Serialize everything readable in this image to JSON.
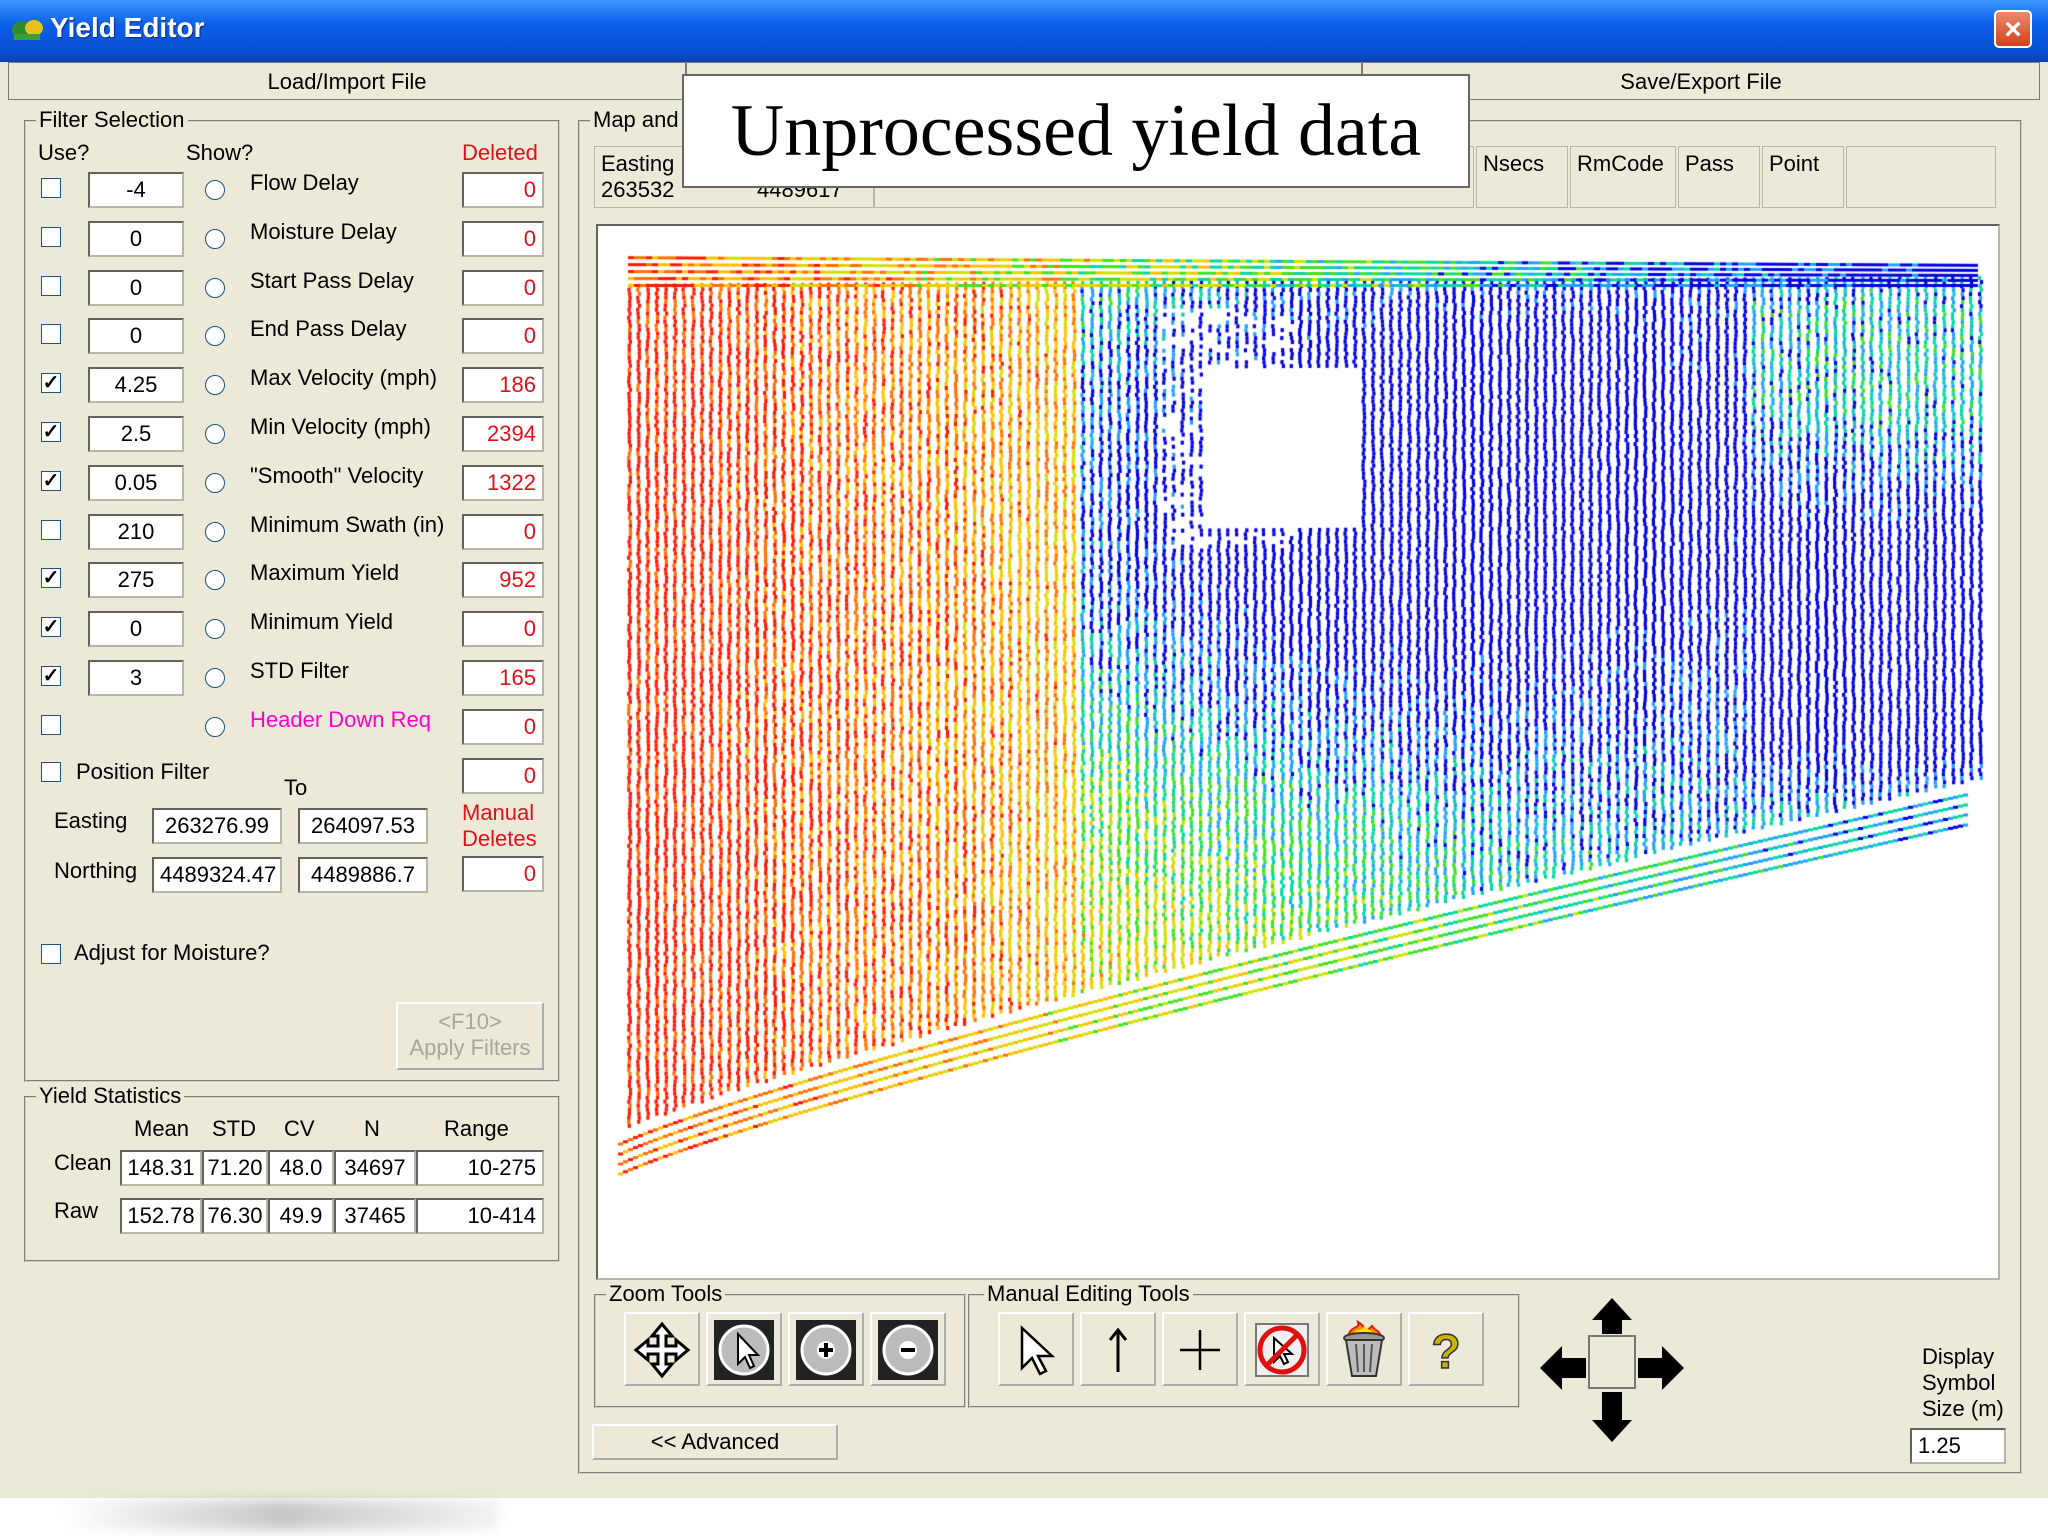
{
  "window": {
    "title": "Yield Editor"
  },
  "tabs": [
    {
      "label": "Load/Import File"
    },
    {
      "label": ""
    },
    {
      "label": "Save/Export File"
    }
  ],
  "overlay_text": "Unprocessed yield data",
  "filter": {
    "title": "Filter Selection",
    "use_label": "Use?",
    "show_label": "Show?",
    "deleted_label": "Deleted",
    "rows": [
      {
        "name": "Flow Delay",
        "checked": false,
        "value": "-4",
        "deleted": "0",
        "color": "#000000"
      },
      {
        "name": "Moisture Delay",
        "checked": false,
        "value": "0",
        "deleted": "0",
        "color": "#000000"
      },
      {
        "name": "Start Pass Delay",
        "checked": false,
        "value": "0",
        "deleted": "0",
        "color": "#000000"
      },
      {
        "name": "End Pass Delay",
        "checked": false,
        "value": "0",
        "deleted": "0",
        "color": "#000000"
      },
      {
        "name": "Max Velocity (mph)",
        "checked": true,
        "value": "4.25",
        "deleted": "186",
        "color": "#000000"
      },
      {
        "name": "Min Velocity (mph)",
        "checked": true,
        "value": "2.5",
        "deleted": "2394",
        "color": "#000000"
      },
      {
        "name": "\"Smooth\" Velocity",
        "checked": true,
        "value": "0.05",
        "deleted": "1322",
        "color": "#000000"
      },
      {
        "name": "Minimum Swath (in)",
        "checked": false,
        "value": "210",
        "deleted": "0",
        "color": "#000000"
      },
      {
        "name": "Maximum Yield",
        "checked": true,
        "value": "275",
        "deleted": "952",
        "color": "#000000"
      },
      {
        "name": "Minimum Yield",
        "checked": true,
        "value": "0",
        "deleted": "0",
        "color": "#000000"
      },
      {
        "name": "STD Filter",
        "checked": true,
        "value": "3",
        "deleted": "165",
        "color": "#000000"
      },
      {
        "name": "Header Down Req",
        "checked": false,
        "value": "",
        "deleted": "0",
        "color": "#ff00cc"
      }
    ],
    "position": {
      "label": "Position Filter",
      "deleted": "0",
      "to_label": "To",
      "easting_label": "Easting",
      "northing_label": "Northing",
      "easting_from": "263276.99",
      "easting_to": "264097.53",
      "northing_from": "4489324.47",
      "northing_to": "4489886.7",
      "manual_label": "Manual",
      "deletes_label": "Deletes",
      "manual_deletes": "0"
    },
    "moisture_label": "Adjust for Moisture?",
    "apply_key": "<F10>",
    "apply_label": "Apply Filters"
  },
  "stats": {
    "title": "Yield Statistics",
    "headers": [
      "Mean",
      "STD",
      "CV",
      "N",
      "Range"
    ],
    "rows": [
      {
        "label": "Clean",
        "values": [
          "148.31",
          "71.20",
          "48.0",
          "34697",
          "10-275"
        ]
      },
      {
        "label": "Raw",
        "values": [
          "152.78",
          "76.30",
          "49.9",
          "37465",
          "10-414"
        ]
      }
    ]
  },
  "map": {
    "title": "Map and",
    "columns": [
      {
        "label": "Easting",
        "value": "263532"
      },
      {
        "label": "",
        "value": "4489617"
      },
      {
        "label": "Nsecs",
        "value": ""
      },
      {
        "label": "RmCode",
        "value": ""
      },
      {
        "label": "Pass",
        "value": ""
      },
      {
        "label": "Point",
        "value": ""
      }
    ]
  },
  "zoom_tools": {
    "title": "Zoom Tools",
    "items": [
      "pan-icon",
      "zoom-window-icon",
      "zoom-in-icon",
      "zoom-out-icon"
    ]
  },
  "edit_tools": {
    "title": "Manual Editing Tools",
    "items": [
      "select-arrow-icon",
      "up-arrow-icon",
      "crosshair-icon",
      "no-edit-icon",
      "trash-fire-icon",
      "help-icon"
    ]
  },
  "advanced_label": "<< Advanced",
  "display_symbol": {
    "line1": "Display",
    "line2": "Symbol",
    "line3": "Size (m)",
    "value": "1.25"
  },
  "colors": {
    "title_bar": "#0a5fe8",
    "deleted_text": "#e0101a",
    "header_down": "#ff00cc",
    "face": "#ece9d8"
  },
  "yield_palette": [
    "#0000e0",
    "#20a0ff",
    "#00d8a0",
    "#40e020",
    "#d0e000",
    "#ffc000",
    "#ff7000",
    "#ff1800"
  ]
}
